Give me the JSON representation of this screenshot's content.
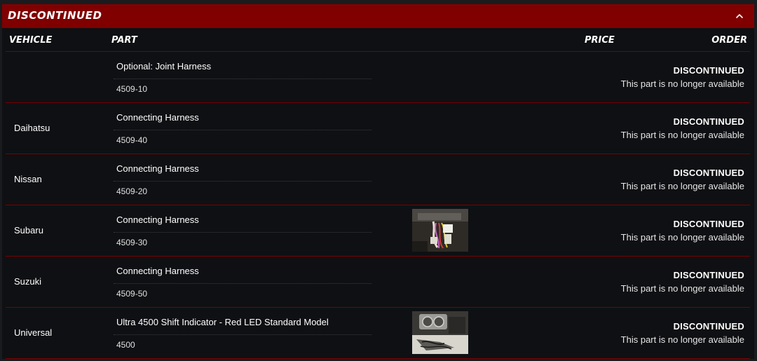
{
  "section": {
    "title": "DISCONTINUED",
    "collapse_icon": "chevron-up-icon"
  },
  "columns": {
    "vehicle": "VEHICLE",
    "part": "PART",
    "price": "PRICE",
    "order": "ORDER"
  },
  "colors": {
    "header_bg": "#800000",
    "panel_bg": "#0f1013",
    "divider": "#7a0000",
    "text": "#ffffff"
  },
  "rows": [
    {
      "vehicle": "",
      "part_name": "Optional: Joint Harness",
      "part_number": "4509-10",
      "has_image": false,
      "order_status": "DISCONTINUED",
      "order_note": "This part is no longer available"
    },
    {
      "vehicle": "Daihatsu",
      "part_name": "Connecting Harness",
      "part_number": "4509-40",
      "has_image": false,
      "order_status": "DISCONTINUED",
      "order_note": "This part is no longer available"
    },
    {
      "vehicle": "Nissan",
      "part_name": "Connecting Harness",
      "part_number": "4509-20",
      "has_image": false,
      "order_status": "DISCONTINUED",
      "order_note": "This part is no longer available"
    },
    {
      "vehicle": "Subaru",
      "part_name": "Connecting Harness",
      "part_number": "4509-30",
      "has_image": true,
      "order_status": "DISCONTINUED",
      "order_note": "This part is no longer available"
    },
    {
      "vehicle": "Suzuki",
      "part_name": "Connecting Harness",
      "part_number": "4509-50",
      "has_image": false,
      "order_status": "DISCONTINUED",
      "order_note": "This part is no longer available"
    },
    {
      "vehicle": "Universal",
      "part_name": "Ultra 4500 Shift Indicator - Red LED Standard Model",
      "part_number": "4500",
      "has_image": true,
      "order_status": "DISCONTINUED",
      "order_note": "This part is no longer available"
    }
  ]
}
